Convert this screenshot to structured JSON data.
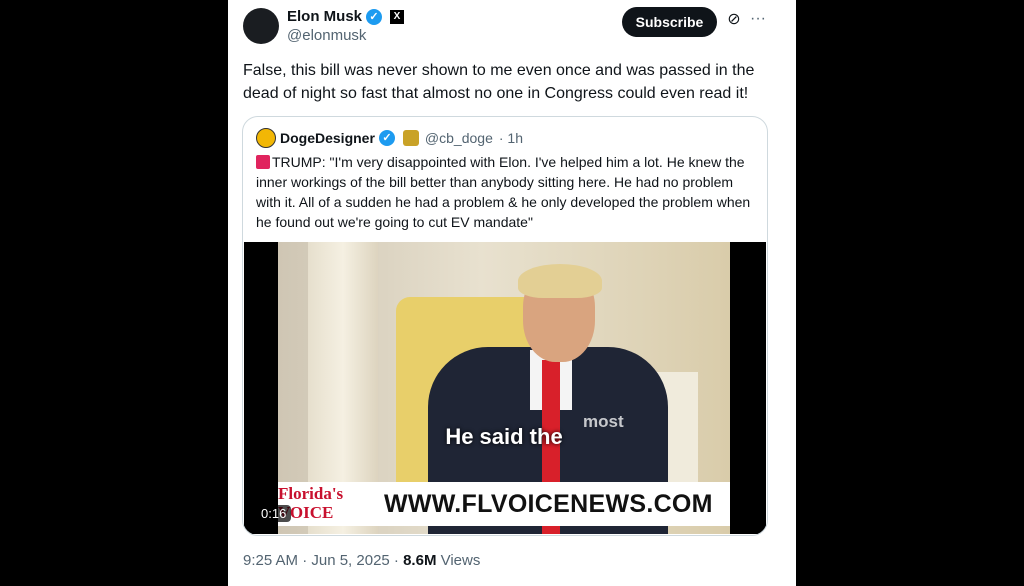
{
  "author": {
    "name": "Elon Musk",
    "handle": "@elonmusk",
    "affiliate_badge": "X"
  },
  "actions": {
    "subscribe_label": "Subscribe",
    "more_icon": "more-horizontal-icon",
    "grok_icon": "grok-icon"
  },
  "tweet": {
    "text": "False, this bill was never shown to me even once and was passed in the dead of night so fast that almost no one in Congress could even read it!"
  },
  "quoted_tweet": {
    "author_name": "DogeDesigner",
    "handle": "@cb_doge",
    "time": "· 1h",
    "text": "TRUMP: \"I'm very disappointed with Elon. I've helped him a lot. He knew the inner workings of the bill better than anybody sitting here. He had no problem with it. All of a sudden he had a problem & he only developed the problem when he found out we're going to cut EV mandate\"",
    "video": {
      "caption_main": "He said the",
      "caption_next": "most",
      "banner_logo": "Florida's VOICE",
      "banner_url": "WWW.FLVOICENEWS.COM",
      "duration": "0:16"
    }
  },
  "meta": {
    "timestamp": "9:25 AM · Jun 5, 2025 · ",
    "views_count": "8.6M",
    "views_label": " Views"
  },
  "colors": {
    "verified": "#1d9bf0",
    "subscribe_bg": "#0f1419",
    "secondary_text": "#536471"
  }
}
